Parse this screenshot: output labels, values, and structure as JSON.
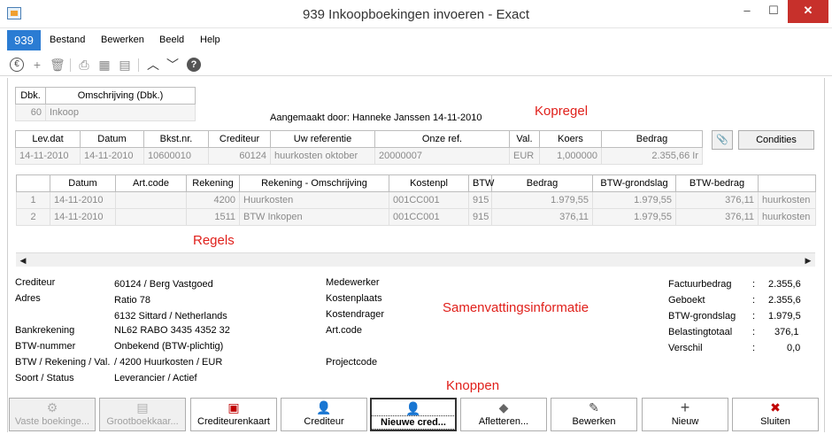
{
  "window": {
    "title": "939 Inkoopboekingen invoeren - Exact",
    "min": "–",
    "max": "☐",
    "close": "✕"
  },
  "menu": {
    "number": "939",
    "items": [
      "Bestand",
      "Bewerken",
      "Beeld",
      "Help"
    ]
  },
  "toolbar": {
    "icons": [
      "euro-icon",
      "add-icon",
      "delete-icon",
      "preview-icon",
      "grid-icon",
      "note-icon",
      "up-icon",
      "down-icon",
      "help-icon"
    ]
  },
  "journal": {
    "headers": [
      "Dbk.",
      "Omschrijving (Dbk.)"
    ],
    "code": "60",
    "description": "Inkoop"
  },
  "created_by": "Aangemaakt door: Hanneke Janssen  14-11-2010",
  "annotations": {
    "kopregel": "Kopregel",
    "regels": "Regels",
    "summary": "Samenvattingsinformatie",
    "knoppen": "Knoppen"
  },
  "header_grid": {
    "headers": [
      "Lev.dat",
      "Datum",
      "Bkst.nr.",
      "Crediteur",
      "Uw referentie",
      "Onze ref.",
      "Val.",
      "Koers",
      "Bedrag"
    ],
    "row": [
      "14-11-2010",
      "14-11-2010",
      "10600010",
      "60124",
      "huurkosten oktober",
      "20000007",
      "EUR",
      "1,000000",
      "2.355,66"
    ],
    "overflow": "Ir"
  },
  "condities_button": "Condities",
  "lines_grid": {
    "headers": [
      "",
      "Datum",
      "Art.code",
      "Rekening",
      "Rekening - Omschrijving",
      "Kostenpl",
      "BTW",
      "Bedrag",
      "BTW-grondslag",
      "BTW-bedrag",
      ""
    ],
    "rows": [
      [
        "1",
        "14-11-2010",
        "",
        "4200",
        "Huurkosten",
        "001CC001",
        "915",
        "1.979,55",
        "1.979,55",
        "376,11",
        "huurkosten"
      ],
      [
        "2",
        "14-11-2010",
        "",
        "1511",
        "BTW Inkopen",
        "001CC001",
        "915",
        "376,11",
        "1.979,55",
        "376,11",
        "huurkosten"
      ]
    ]
  },
  "summary_left": [
    {
      "label": "Crediteur",
      "value": "60124 / Berg Vastgoed"
    },
    {
      "label": "Adres",
      "value": "Ratio 78"
    },
    {
      "label": "",
      "value": "6132 Sittard / Netherlands"
    },
    {
      "label": "Bankrekening",
      "value": "NL62 RABO 3435 4352 32"
    },
    {
      "label": "BTW-nummer",
      "value": "Onbekend (BTW-plichtig)"
    },
    {
      "label": "BTW / Rekening / Val.",
      "value": "/ 4200 Huurkosten / EUR"
    },
    {
      "label": "Soort / Status",
      "value": "Leverancier / Actief"
    }
  ],
  "summary_mid": [
    "Medewerker",
    "Kostenplaats",
    "Kostendrager",
    "Art.code",
    "",
    "Projectcode"
  ],
  "summary_right": [
    {
      "label": "Factuurbedrag",
      "sep": ":",
      "value": "2.355,6"
    },
    {
      "label": "Geboekt",
      "sep": ":",
      "value": "2.355,6"
    },
    {
      "label": "BTW-grondslag",
      "sep": ":",
      "value": "1.979,5"
    },
    {
      "label": "Belastingtotaal",
      "sep": ":",
      "value": "376,1"
    },
    {
      "label": "Verschil",
      "sep": ":",
      "value": "0,0"
    }
  ],
  "buttons": [
    {
      "label": "Vaste boekinge...",
      "icon": "⚙",
      "state": "disabled"
    },
    {
      "label": "Grootboekkaar...",
      "icon": "▤",
      "state": "disabled"
    },
    {
      "label": "Crediteurenkaart",
      "icon": "▣",
      "state": "normal"
    },
    {
      "label": "Crediteur",
      "icon": "👤",
      "state": "normal"
    },
    {
      "label": "Nieuwe cred...",
      "icon": "👤",
      "state": "focused"
    },
    {
      "label": "Afletteren...",
      "icon": "◆",
      "state": "normal"
    },
    {
      "label": "Bewerken",
      "icon": "✎",
      "state": "normal"
    },
    {
      "label": "Nieuw",
      "icon": "+",
      "state": "normal"
    },
    {
      "label": "Sluiten",
      "icon": "✖",
      "state": "normal"
    }
  ],
  "colors": {
    "accent": "#2b7cd3",
    "annotation": "#e0201b",
    "close": "#c7302b",
    "icon_red": "#c00000"
  }
}
